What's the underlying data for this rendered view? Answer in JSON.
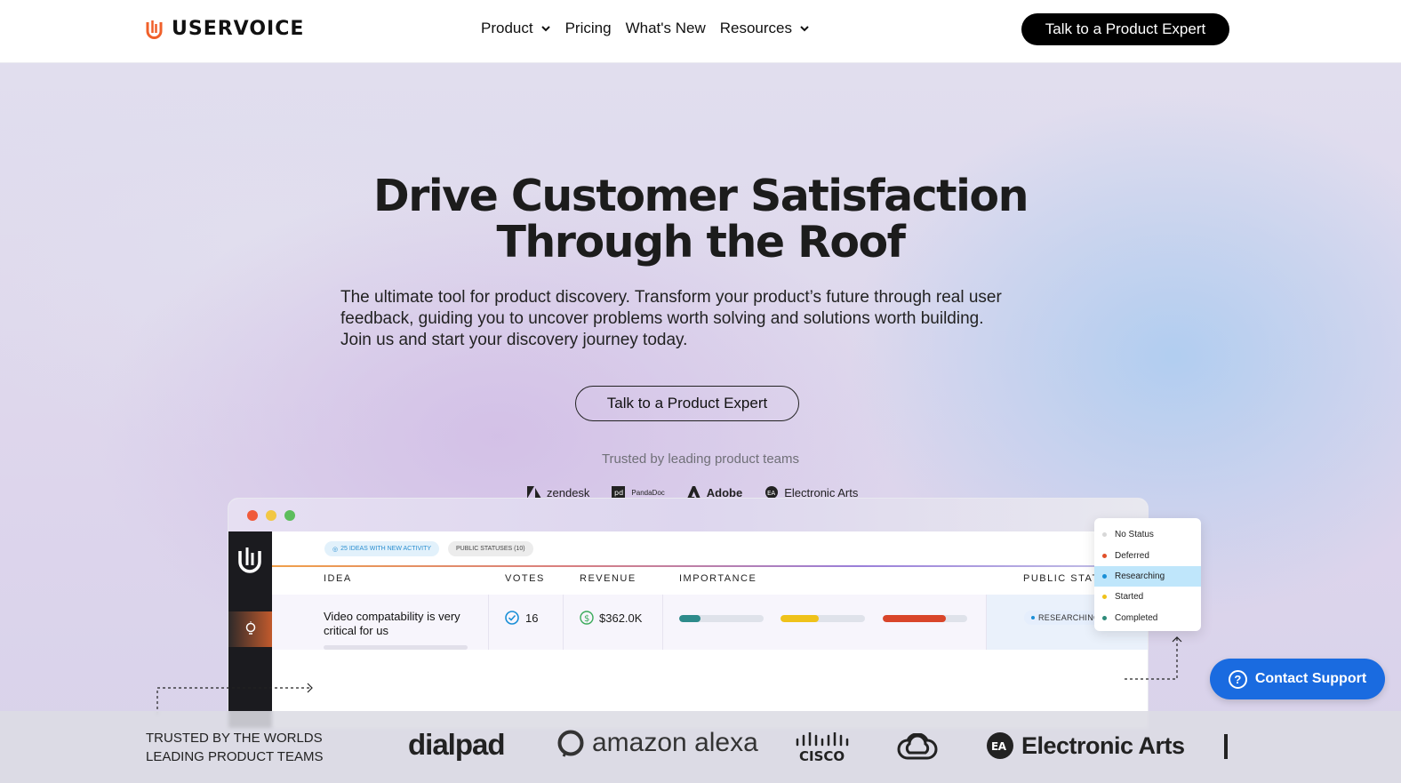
{
  "nav": {
    "brand": "USERVOICE",
    "links": [
      {
        "label": "Product",
        "has_dropdown": true
      },
      {
        "label": "Pricing",
        "has_dropdown": false
      },
      {
        "label": "What's New",
        "has_dropdown": false
      },
      {
        "label": "Resources",
        "has_dropdown": true
      }
    ],
    "cta": "Talk to a Product Expert"
  },
  "hero": {
    "title_line1": "Drive Customer Satisfaction",
    "title_line2": "Through the Roof",
    "subtitle": "The ultimate tool for product discovery. Transform your product’s future through real user feedback, guiding you to uncover problems worth solving and solutions worth building. Join us and start your discovery journey today.",
    "cta": "Talk to a Product Expert",
    "trusted_label": "Trusted by leading product teams",
    "trusted_logos": [
      "zendesk",
      "PandaDoc",
      "Adobe",
      "Electronic Arts"
    ]
  },
  "app_preview": {
    "pills": [
      "25 IDEAS WITH NEW ACTIVITY",
      "PUBLIC STATUSES (10)"
    ],
    "columns": [
      "IDEA",
      "VOTES",
      "REVENUE",
      "IMPORTANCE",
      "PUBLIC STATUS"
    ],
    "row": {
      "idea": "Video compatability is very critical for us",
      "votes": "16",
      "revenue": "$362.0K",
      "importance": [
        0.25,
        0.45,
        0.75
      ],
      "status": "RESEARCHING"
    },
    "status_options": [
      {
        "label": "No Status",
        "color": "#d8d8d8"
      },
      {
        "label": "Deferred",
        "color": "#e0502a"
      },
      {
        "label": "Researching",
        "color": "#1a8fd6"
      },
      {
        "label": "Started",
        "color": "#efc21a"
      },
      {
        "label": "Completed",
        "color": "#2e8b7a"
      }
    ],
    "selected_status": "Researching"
  },
  "support": {
    "label": "Contact Support"
  },
  "band": {
    "title_line1": "TRUSTED BY THE WORLDS",
    "title_line2": "LEADING PRODUCT TEAMS",
    "logos": [
      "dialpad",
      "amazon alexa",
      "CISCO",
      "creative-cloud-icon",
      "Electronic Arts"
    ]
  },
  "colors": {
    "brand_orange": "#f0602a",
    "contact_blue": "#1a6be0",
    "bar_teal": "#2e8b8b",
    "bar_yellow": "#efc21a",
    "bar_red": "#d9452a"
  }
}
